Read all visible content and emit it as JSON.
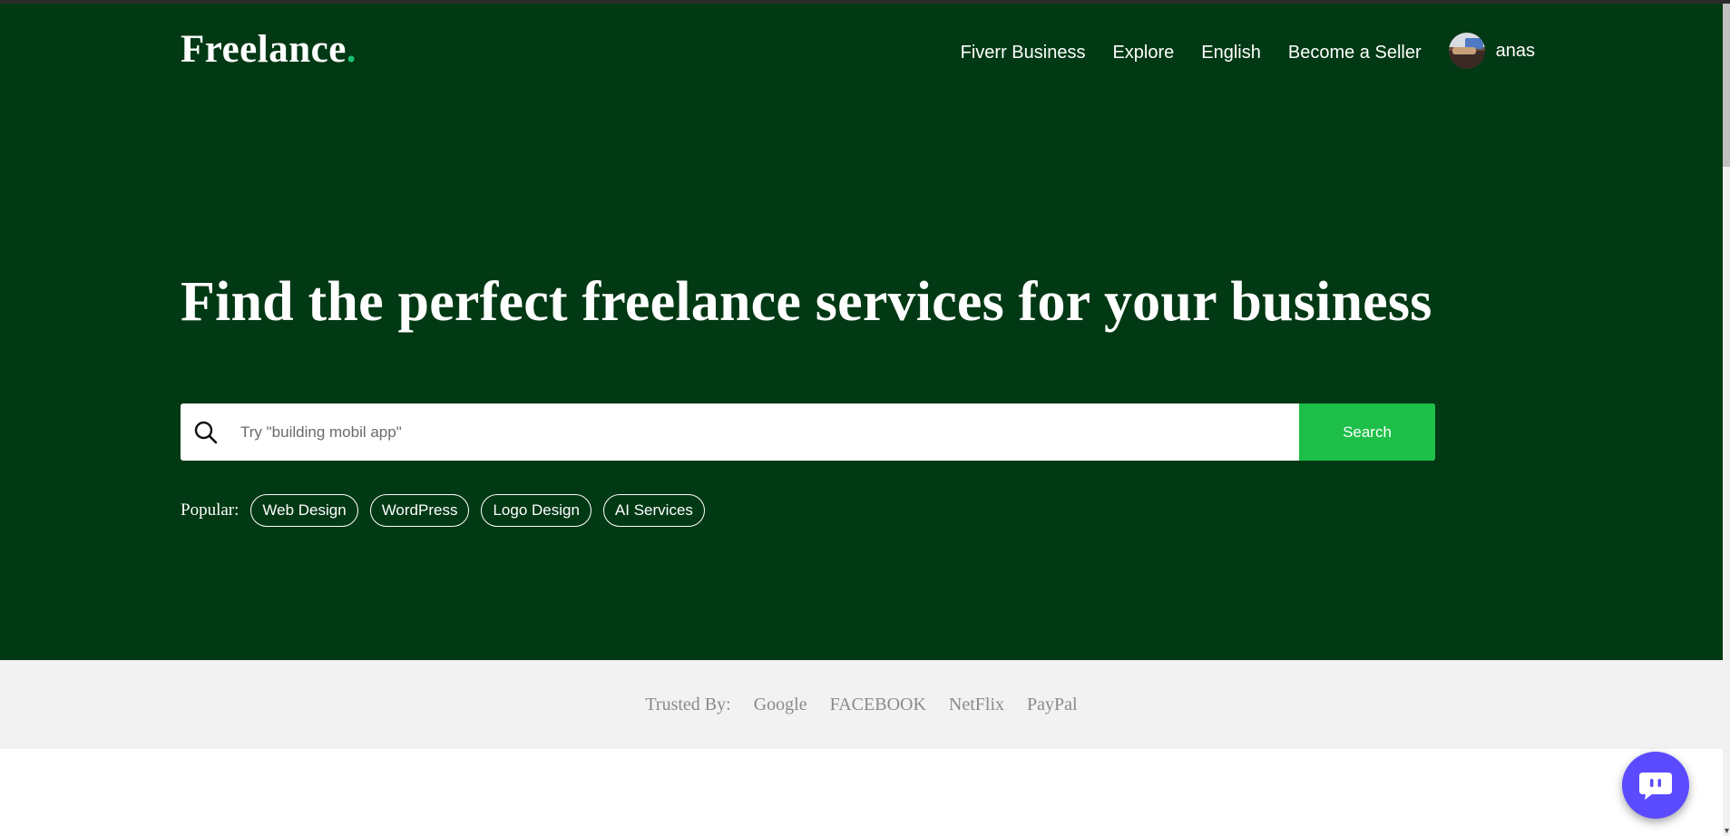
{
  "brand": {
    "name": "Freelance",
    "dot": "."
  },
  "nav": {
    "links": [
      "Fiverr Business",
      "Explore",
      "English",
      "Become a Seller"
    ],
    "user_name": "anas"
  },
  "hero": {
    "headline": "Find the perfect freelance services for your business",
    "search": {
      "placeholder": "Try \"building mobil app\"",
      "value": "",
      "button_label": "Search"
    },
    "popular_label": "Popular:",
    "popular_tags": [
      "Web Design",
      "WordPress",
      "Logo Design",
      "AI Services"
    ]
  },
  "trusted": {
    "label": "Trusted By:",
    "brands": [
      "Google",
      "FACEBOOK",
      "NetFlix",
      "PayPal"
    ]
  },
  "colors": {
    "hero_bg": "#013914",
    "accent_green": "#1dbf73",
    "search_button": "#1dbf49",
    "trusted_bg": "#f2f2f2",
    "chat_button": "#5b4bff"
  },
  "icons": [
    "search-icon",
    "chat-icon",
    "avatar"
  ]
}
